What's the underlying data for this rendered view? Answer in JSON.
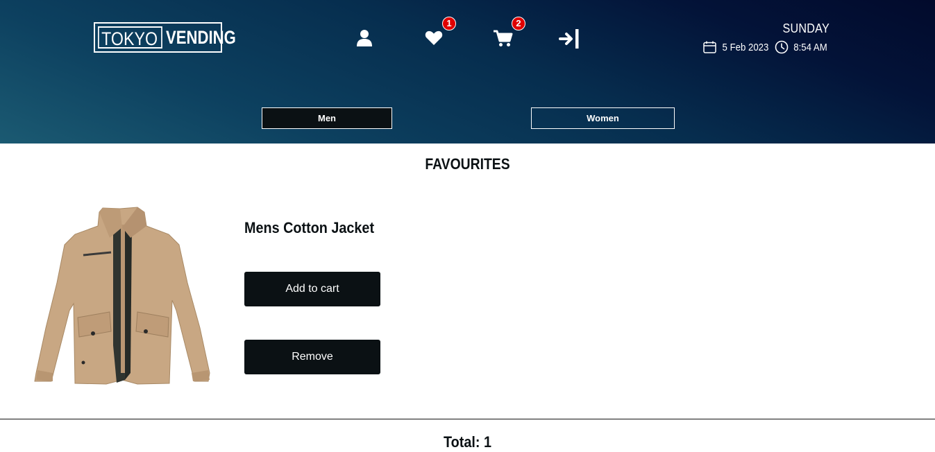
{
  "header": {
    "logo": {
      "part1": "TOKYO",
      "part2": "VENDING"
    },
    "wishlist_count": "1",
    "cart_count": "2",
    "day": "SUNDAY",
    "date": "5 Feb 2023",
    "time": "8:54 AM",
    "icons": [
      "user-icon",
      "heart-icon",
      "cart-icon",
      "sign-in-icon",
      "calendar-icon",
      "clock-icon"
    ]
  },
  "categories": [
    {
      "label": "Men",
      "active": true
    },
    {
      "label": "Women",
      "active": false
    }
  ],
  "page": {
    "title": "FAVOURITES"
  },
  "favourites": [
    {
      "name": "Mens Cotton Jacket",
      "add_label": "Add to cart",
      "remove_label": "Remove"
    }
  ],
  "summary": {
    "total": "Total: 1"
  },
  "colors": {
    "header_dark": "#020a2c",
    "header_teal": "#1b5a72",
    "button_bg": "#0b1114",
    "badge": "#e00000"
  }
}
